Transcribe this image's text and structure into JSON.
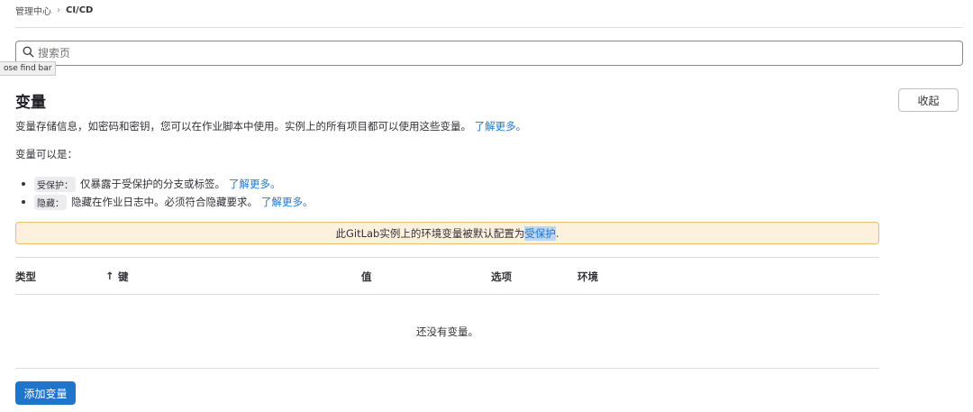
{
  "breadcrumb": {
    "parent": "管理中心",
    "separator": "›",
    "current": "CI/CD"
  },
  "search": {
    "placeholder": "搜索页"
  },
  "tooltip": {
    "text": "ose find bar"
  },
  "section": {
    "title": "变量",
    "collapse_label": "收起",
    "description": "变量存储信息，如密码和密钥，您可以在作业脚本中使用。实例上的所有项目都可以使用这些变量。",
    "learn_more": "了解更多。",
    "can_be": "变量可以是："
  },
  "options": [
    {
      "tag": "受保护：",
      "text": "仅暴露于受保护的分支或标签。",
      "link": "了解更多。"
    },
    {
      "tag": "隐藏：",
      "text": "隐藏在作业日志中。必须符合隐藏要求。",
      "link": "了解更多。"
    }
  ],
  "alert": {
    "prefix": "此GitLab实例上的环境变量被默认配置为",
    "highlight": "受保护",
    "suffix": "."
  },
  "table": {
    "col_type": "类型",
    "sort_arrow": "↑",
    "col_key": "键",
    "col_value": "值",
    "col_options": "选项",
    "col_env": "环境",
    "empty": "还没有变量。"
  },
  "add_button": "添加变量",
  "colors": {
    "accent": "#1f75cb",
    "alert_bg": "#fdf1dd",
    "alert_border": "#e9be74"
  }
}
